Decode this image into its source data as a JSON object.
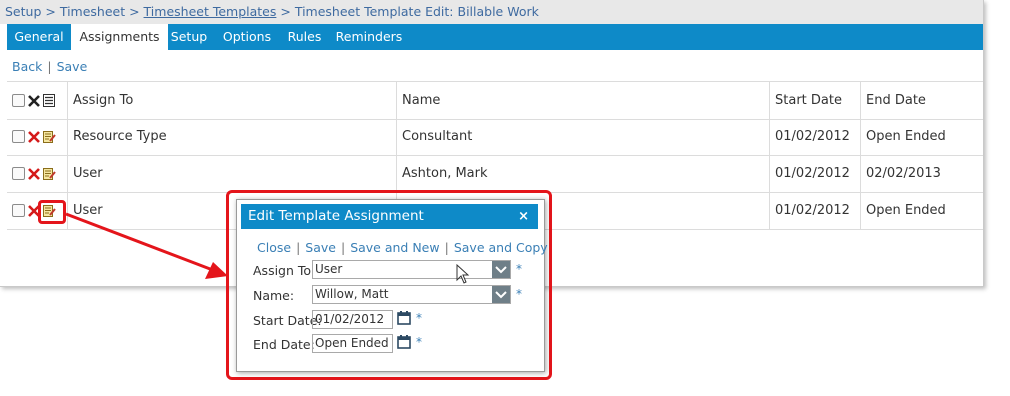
{
  "breadcrumb": {
    "setup": "Setup",
    "sep1": " > ",
    "timesheet": "Timesheet",
    "sep2": " > ",
    "templates": "Timesheet Templates",
    "sep3": " > ",
    "current": "Timesheet Template Edit: Billable Work"
  },
  "tabs": [
    "General",
    "Assignments",
    "Setup",
    "Options",
    "Rules",
    "Reminders"
  ],
  "active_tab": "Assignments",
  "actions": {
    "back": "Back",
    "sep": "|",
    "save": "Save"
  },
  "table": {
    "headers": {
      "assign_to": "Assign To",
      "name": "Name",
      "start_date": "Start Date",
      "end_date": "End Date"
    },
    "rows": [
      {
        "assign_to": "Resource Type",
        "name": "Consultant",
        "start_date": "01/02/2012",
        "end_date": "Open Ended"
      },
      {
        "assign_to": "User",
        "name": "Ashton, Mark",
        "start_date": "01/02/2012",
        "end_date": "02/02/2013"
      },
      {
        "assign_to": "User",
        "name": "",
        "start_date": "01/02/2012",
        "end_date": "Open Ended"
      }
    ]
  },
  "dialog": {
    "title": "Edit Template Assignment",
    "close_icon": "×",
    "actions": {
      "close": "Close",
      "save": "Save",
      "save_new": "Save and New",
      "save_copy": "Save and Copy",
      "sep": "|"
    },
    "fields": {
      "assign_to_label": "Assign To:",
      "assign_to_value": "User",
      "name_label": "Name:",
      "name_value": "Willow, Matt",
      "start_label": "Start Date:",
      "start_value": "01/02/2012",
      "end_label": "End Date:",
      "end_value": "Open Ended",
      "required": "*"
    }
  },
  "colors": {
    "accent": "#0e8ac8",
    "link": "#3a7fb5",
    "highlight": "#e4151b"
  }
}
